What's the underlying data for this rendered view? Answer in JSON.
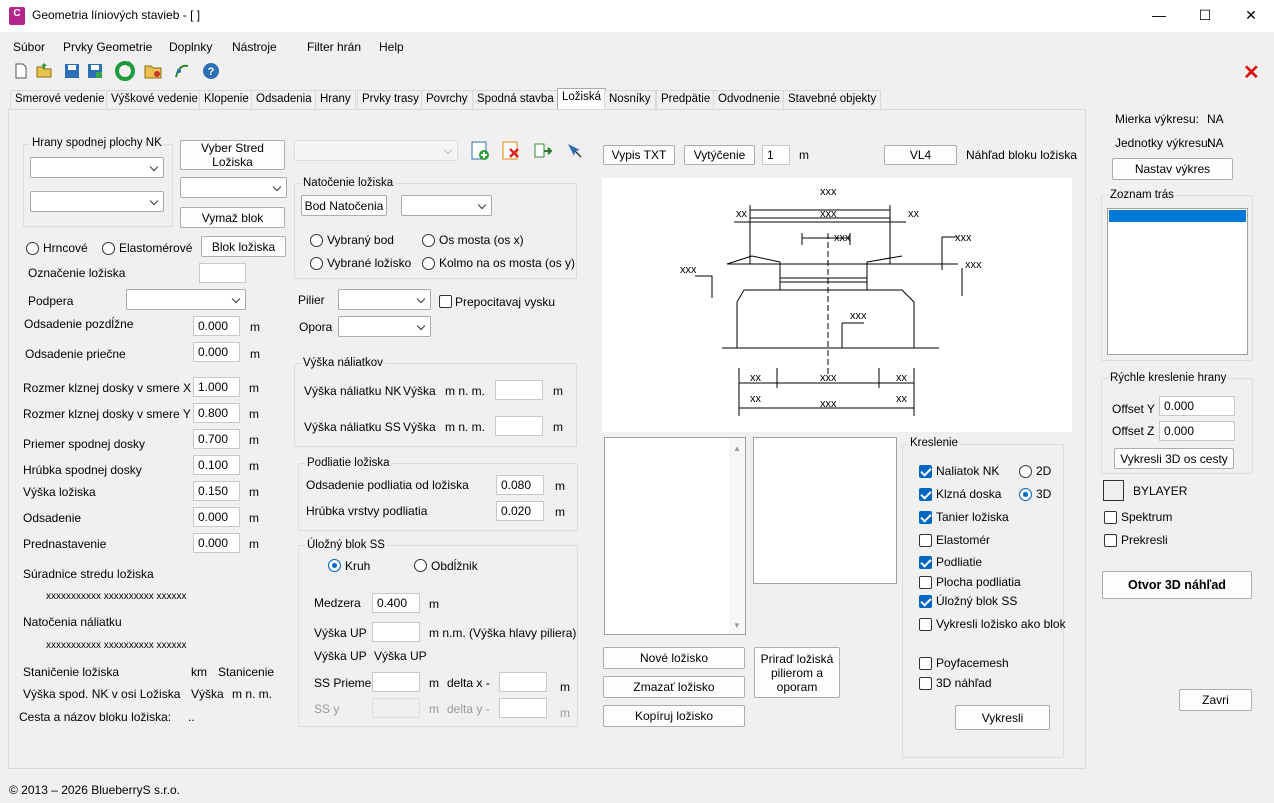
{
  "window": {
    "app_icon": "C",
    "title": "Geometria líniových stavieb - [ ]",
    "min": "—",
    "max": "☐",
    "close": "✕"
  },
  "menu": [
    "Súbor",
    "Prvky Geometrie",
    "Doplnky",
    "Nástroje",
    "Filter hrán",
    "Help"
  ],
  "close_x": "✕",
  "tabs": [
    "Smerové vedenie",
    "Výškové vedenie",
    "Klopenie",
    "Odsadenia",
    "Hrany",
    "Prvky trasy",
    "Povrchy",
    "Spodná stavba",
    "Ložiská",
    "Nosníky",
    "Predpätie",
    "Odvodnenie",
    "Stavebné objekty"
  ],
  "left": {
    "hrany_title": "Hrany spodnej plochy NK",
    "vyber_stred": "Vyber Stred Ložiska",
    "vymaz_blok": "Vymaž blok",
    "r_hrncove": "Hrncové",
    "r_elasto": "Elastomérové",
    "blok_lozisko": "Blok ložiska",
    "oznacenie": "Označenie ložiska",
    "podpera": "Podpera",
    "odsadenie_pozdlzne": "Odsadenie pozdĺžne",
    "odsadenie_priecne": "Odsadenie priečne",
    "rozmer_x": "Rozmer klznej dosky v smere X",
    "rozmer_y": "Rozmer klznej dosky v smere Y",
    "priemer_spod": "Priemer spodnej dosky",
    "hrubka_spod": "Hrúbka spodnej dosky",
    "vyska_loziska": "Výška ložiska",
    "odsadenie": "Odsadenie",
    "prednastavenie": "Prednastavenie",
    "v_pozd": "0.000",
    "v_prie": "0.000",
    "v_rx": "1.000",
    "v_ry": "0.800",
    "v_pri": "0.700",
    "v_hru": "0.100",
    "v_vys": "0.150",
    "v_ods": "0.000",
    "v_pre": "0.000",
    "unit": "m",
    "suradnice": "Súradnice stredu ložiska",
    "sur_val": "xxxxxxxxxxx xxxxxxxxxx xxxxxx",
    "natocenie": "Natočenia náliatku",
    "nat_val": "xxxxxxxxxxx xxxxxxxxxx xxxxxx",
    "stanicenie": "Staničenie ložiska",
    "km": "km",
    "stanicenie2": "Stanicenie",
    "vyska_spod": "Výška spod. NK v osi Ložiska",
    "vyska": "Výška",
    "mnm": "m n. m.",
    "cesta": "Cesta a názov bloku ložiska:",
    "cesta_val": ".."
  },
  "mid": {
    "nat_title": "Natočenie ložiska",
    "bod_nat": "Bod Natočenia",
    "r_vybrany_bod": "Vybraný bod",
    "r_os_mosta": "Os mosta (os x)",
    "r_vybrane_lozisko": "Vybrané ložisko",
    "r_kolmo": "Kolmo na os mosta (os y)",
    "pilier": "Pilier",
    "opora": "Opora",
    "prepocitavaj": "Prepocitavaj vysku",
    "vyska_nal_title": "Výška náliatkov",
    "vnk": "Výška náliatku NK",
    "vss": "Výška náliatku SS",
    "vyska": "Výška",
    "mnm": "m n. m.",
    "m": "m",
    "podliatie_title": "Podliatie ložiska",
    "ods_podl": "Odsadenie podliatia od ložiska",
    "hrub_podl": "Hrúbka vrstvy podliatia",
    "v_ods_podl": "0.080",
    "v_hrub_podl": "0.020",
    "ulozny_title": "Úložný blok SS",
    "kruh": "Kruh",
    "obdlznik": "Obdĺžnik",
    "medzera": "Medzera",
    "v_medzera": "0.400",
    "vyska_up": "Výška UP",
    "mnm2": "m n.m.",
    "hlava": "(Výška hlavy piliera)",
    "vyska_up2": "Výška UP",
    "vyska_up3": "Výška UP",
    "ss_priemer": "SS Priemer",
    "deltax": "delta x -",
    "ssy": "SS y",
    "deltay": "delta y -"
  },
  "right": {
    "vypis": "Vypis TXT",
    "vytycenie": "Vytýčenie",
    "vyt_val": "1",
    "m": "m",
    "vl4": "VL4",
    "nahlad": "Náhľad bloku ložiska",
    "x": "xxx",
    "xx": "xx",
    "nove": "Nové ložisko",
    "zmazat": "Zmazať ložisko",
    "kopiruj": "Kopíruj ložisko",
    "prirad": "Priraď ložiská pilierom a oporam",
    "kreslenie": "Kreslenie",
    "c1": "Naliatok NK",
    "c2": "Klzná doska",
    "c3": "Tanier ložiska",
    "c4": "Elastomér",
    "c5": "Podliatie",
    "c6": "Plocha podliatia",
    "c7": "Úložný blok SS",
    "c8": "Vykresli ložisko ako blok",
    "c9": "Poyfacemesh",
    "c10": "3D náhľad",
    "r2d": "2D",
    "r3d": "3D",
    "vykresli": "Vykresli"
  },
  "side": {
    "mierka": "Mierka výkresu:",
    "mierka_v": "NA",
    "jednotky": "Jednotky výkresu:",
    "jednotky_v": "NA",
    "nastav": "Nastav výkres",
    "zoznam": "Zoznam trás",
    "rychle": "Rýchle kreslenie hrany",
    "offy": "Offset Y",
    "offy_v": "0.000",
    "offz": "Offset Z",
    "offz_v": "0.000",
    "vyk3d": "Vykresli 3D os cesty",
    "bylayer": "BYLAYER",
    "spektrum": "Spektrum",
    "prekresli": "Prekresli",
    "otvor": "Otvor 3D náhľad",
    "zavri": "Zavri"
  },
  "status": "© 2013 – 2026 BlueberryS s.r.o."
}
